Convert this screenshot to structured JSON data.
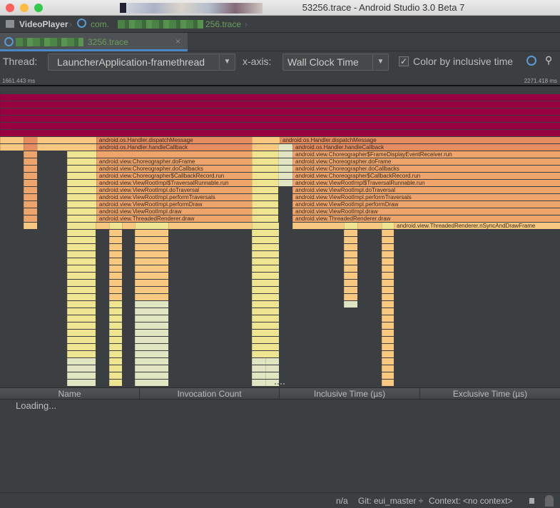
{
  "window": {
    "title": "53256.trace - Android Studio 3.0 Beta 7"
  },
  "breadcrumb": {
    "project": "VideoPlayer",
    "file_prefix": "com.",
    "file_suffix": "256.trace"
  },
  "tab": {
    "label_suffix": "3256.trace",
    "close": "×"
  },
  "toolbar": {
    "thread_label": "Thread:",
    "thread_value": "LauncherApplication-framethread",
    "xaxis_label": "x-axis:",
    "xaxis_value": "Wall Clock Time",
    "color_checkbox_label": "Color by inclusive time",
    "color_checked": true,
    "dropdown_glyph": "▼"
  },
  "ruler": {
    "start": "1661.443 ms",
    "end": "2271.418 ms"
  },
  "flame": {
    "colors": {
      "crimson": "#990041",
      "deep": "#e58c61",
      "orange": "#efa46c",
      "light": "#f8c880",
      "yellow": "#efe48f",
      "pale": "#e1e5c1"
    },
    "left_labels": [
      "android.os.Handler.dispatchMessage",
      "android.os.Handler.handleCallback",
      "",
      "android.view.Choreographer.doFrame",
      "android.view.Choreographer.doCallbacks",
      "android.view.Choreographer$CallbackRecord.run",
      "android.view.ViewRootImpl$TraversalRunnable.run",
      "android.view.ViewRootImpl.doTraversal",
      "android.view.ViewRootImpl.performTraversals",
      "android.view.ViewRootImpl.performDraw",
      "android.view.ViewRootImpl.draw",
      "android.view.ThreadedRenderer.draw"
    ],
    "right_labels": [
      "android.os.Handler.dispatchMessage",
      "android.os.Handler.handleCallback",
      "android.view.Choreographer$FrameDisplayEventReceiver.run",
      "android.view.Choreographer.doFrame",
      "android.view.Choreographer.doCallbacks",
      "android.view.Choreographer$CallbackRecord.run",
      "android.view.ViewRootImpl$TraversalRunnable.run",
      "android.view.ViewRootImpl.doTraversal",
      "android.view.ViewRootImpl.performTraversals",
      "android.view.ViewRootImpl.performDraw",
      "android.view.ViewRootImpl.draw",
      "android.view.ThreadedRenderer.draw",
      "android.view.ThreadedRenderer.nSyncAndDrawFrame"
    ]
  },
  "table": {
    "columns": [
      "Name",
      "Invocation Count",
      "Inclusive Time (µs)",
      "Exclusive Time (µs)"
    ],
    "loading": "Loading..."
  },
  "status": {
    "position": "n/a",
    "git": "Git: eui_master ÷",
    "context": "Context: <no context>"
  }
}
